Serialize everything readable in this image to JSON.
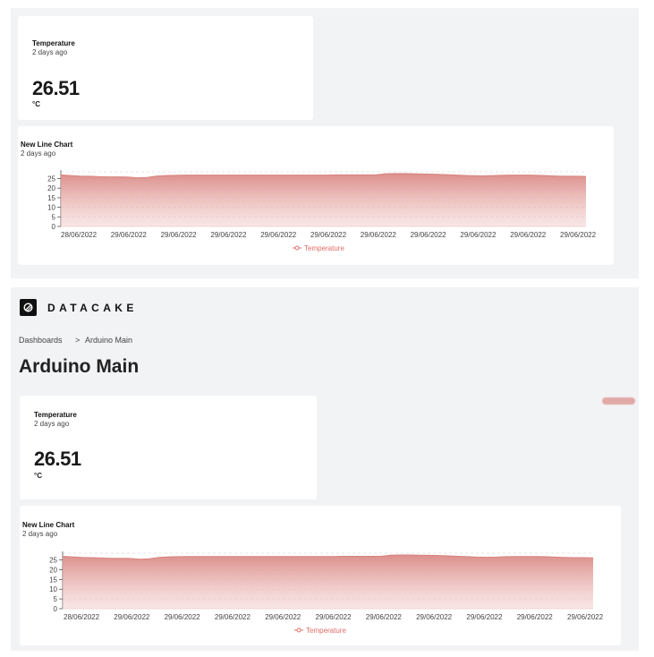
{
  "top_section": {
    "value_card": {
      "title": "Temperature",
      "subtitle": "2 days ago",
      "value": "26.51",
      "unit": "°C"
    },
    "chart_card": {
      "title": "New Line Chart",
      "subtitle": "2 days ago"
    }
  },
  "header": {
    "brand": "DATACAKE",
    "logo_icon": "datacake-logo-icon"
  },
  "breadcrumb": {
    "items": [
      "Dashboards",
      "Arduino Main"
    ],
    "separator": ">"
  },
  "page": {
    "title": "Arduino Main"
  },
  "bottom_section": {
    "value_card": {
      "title": "Temperature",
      "subtitle": "2 days ago",
      "value": "26.51",
      "unit": "°C"
    },
    "chart_card": {
      "title": "New Line Chart",
      "subtitle": "2 days ago"
    }
  },
  "chart_data": [
    {
      "type": "area",
      "x": [
        "28/06/2022",
        "29/06/2022",
        "29/06/2022",
        "29/06/2022",
        "29/06/2022",
        "29/06/2022",
        "29/06/2022",
        "29/06/2022",
        "29/06/2022",
        "29/06/2022",
        "29/06/2022"
      ],
      "yticks": [
        0,
        5,
        10,
        15,
        20,
        25
      ],
      "ylim": [
        0,
        28.5
      ],
      "series": [
        {
          "name": "Temperature",
          "color": "#e06c66",
          "values": [
            26.9,
            26.6,
            26.3,
            26.2,
            26.0,
            25.9,
            25.9,
            25.8,
            25.4,
            25.6,
            26.3,
            26.6,
            26.7,
            26.8,
            26.8,
            26.8,
            26.8,
            26.8,
            26.8,
            26.8,
            26.8,
            26.8,
            26.8,
            26.8,
            26.8,
            26.8,
            26.8,
            26.8,
            26.8,
            26.9,
            26.9,
            26.9,
            26.9,
            26.9,
            27.5,
            27.6,
            27.6,
            27.5,
            27.4,
            27.3,
            27.1,
            26.9,
            26.7,
            26.5,
            26.4,
            26.5,
            26.7,
            26.8,
            26.8,
            26.8,
            26.7,
            26.5,
            26.3,
            26.2,
            26.2,
            26.1
          ]
        }
      ],
      "grid": true,
      "legend": "bottom-center"
    },
    {
      "type": "area",
      "x": [
        "28/06/2022",
        "29/06/2022",
        "29/06/2022",
        "29/06/2022",
        "29/06/2022",
        "29/06/2022",
        "29/06/2022",
        "29/06/2022",
        "29/06/2022",
        "29/06/2022",
        "29/06/2022"
      ],
      "yticks": [
        0,
        5,
        10,
        15,
        20,
        25
      ],
      "ylim": [
        0,
        28.5
      ],
      "series": [
        {
          "name": "Temperature",
          "color": "#e06c66",
          "values": [
            26.9,
            26.6,
            26.3,
            26.2,
            26.0,
            25.9,
            25.9,
            25.8,
            25.4,
            25.6,
            26.3,
            26.6,
            26.7,
            26.8,
            26.8,
            26.8,
            26.8,
            26.8,
            26.8,
            26.8,
            26.8,
            26.8,
            26.8,
            26.8,
            26.8,
            26.8,
            26.8,
            26.8,
            26.8,
            26.9,
            26.9,
            26.9,
            26.9,
            26.9,
            27.5,
            27.6,
            27.6,
            27.5,
            27.4,
            27.3,
            27.1,
            26.9,
            26.7,
            26.5,
            26.4,
            26.5,
            26.7,
            26.8,
            26.8,
            26.8,
            26.7,
            26.5,
            26.3,
            26.2,
            26.2,
            26.1
          ]
        }
      ],
      "grid": true,
      "legend": "bottom-center"
    }
  ]
}
